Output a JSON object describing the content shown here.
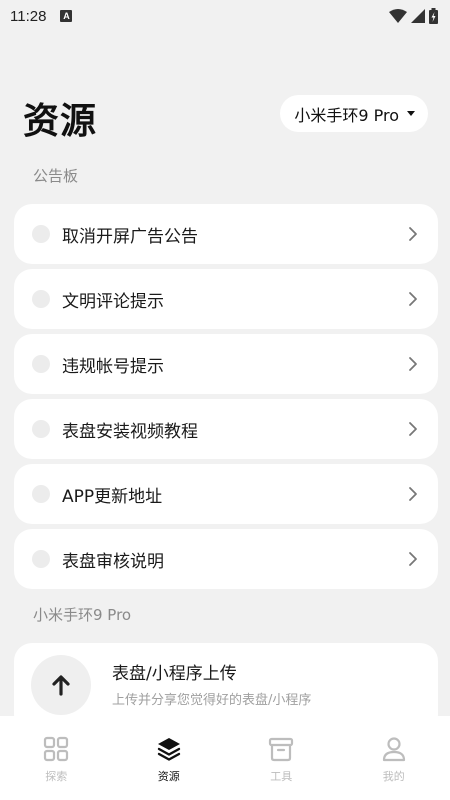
{
  "status_bar": {
    "time": "11:28",
    "notification_letter": "A"
  },
  "header": {
    "title": "资源",
    "device_selector": "小米手环9 Pro"
  },
  "notice_board": {
    "section_label": "公告板",
    "items": [
      {
        "label": "取消开屏广告公告"
      },
      {
        "label": "文明评论提示"
      },
      {
        "label": "违规帐号提示"
      },
      {
        "label": "表盘安装视频教程"
      },
      {
        "label": "APP更新地址"
      },
      {
        "label": "表盘审核说明"
      }
    ]
  },
  "device_section": {
    "section_label": "小米手环9 Pro",
    "upload": {
      "title": "表盘/小程序上传",
      "subtitle": "上传并分享您觉得好的表盘/小程序",
      "icon": "arrow-up-icon"
    }
  },
  "bottom_nav": {
    "active": "资源",
    "items": [
      {
        "label": "探索",
        "icon": "grid-icon"
      },
      {
        "label": "资源",
        "icon": "layers-icon"
      },
      {
        "label": "工具",
        "icon": "archive-box-icon"
      },
      {
        "label": "我的",
        "icon": "person-icon"
      }
    ]
  },
  "colors": {
    "background": "#f1f1f1",
    "card": "#ffffff",
    "active_nav": "#111111",
    "inactive_nav": "#bdbdbd"
  }
}
